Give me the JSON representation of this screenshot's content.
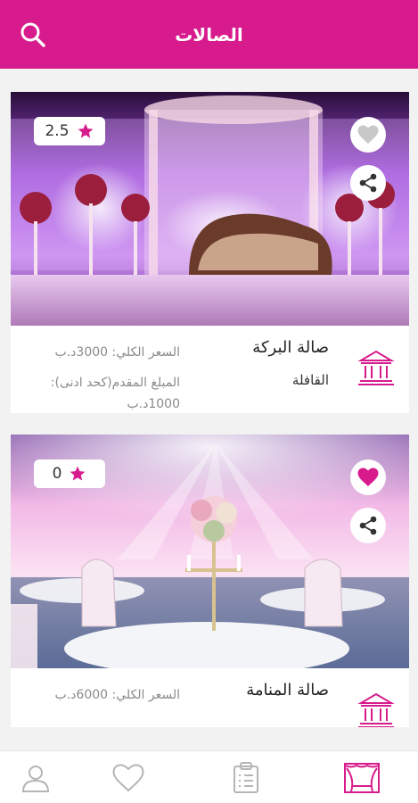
{
  "header": {
    "title": "الصالات"
  },
  "halls": [
    {
      "name": "صالة البركة",
      "city": "القافلة",
      "rating": "2.5",
      "price_total": "السعر الكلي: 3000د.ب",
      "price_deposit": "المبلغ المقدم(كحد ادنى): 1000د.ب",
      "favorited": false
    },
    {
      "name": "صالة المنامة",
      "city": "",
      "rating": "0",
      "price_total": "السعر الكلي: 6000د.ب",
      "price_deposit": "",
      "favorited": true
    }
  ],
  "tabs": [
    {
      "icon": "user-icon",
      "active": false
    },
    {
      "icon": "heart-icon",
      "active": false
    },
    {
      "icon": "clipboard-icon",
      "active": false
    },
    {
      "icon": "stage-icon",
      "active": true
    }
  ],
  "colors": {
    "primary": "#d81b8c",
    "inactive_icon": "#b5b5b5",
    "price_text": "#8a8a8a"
  }
}
